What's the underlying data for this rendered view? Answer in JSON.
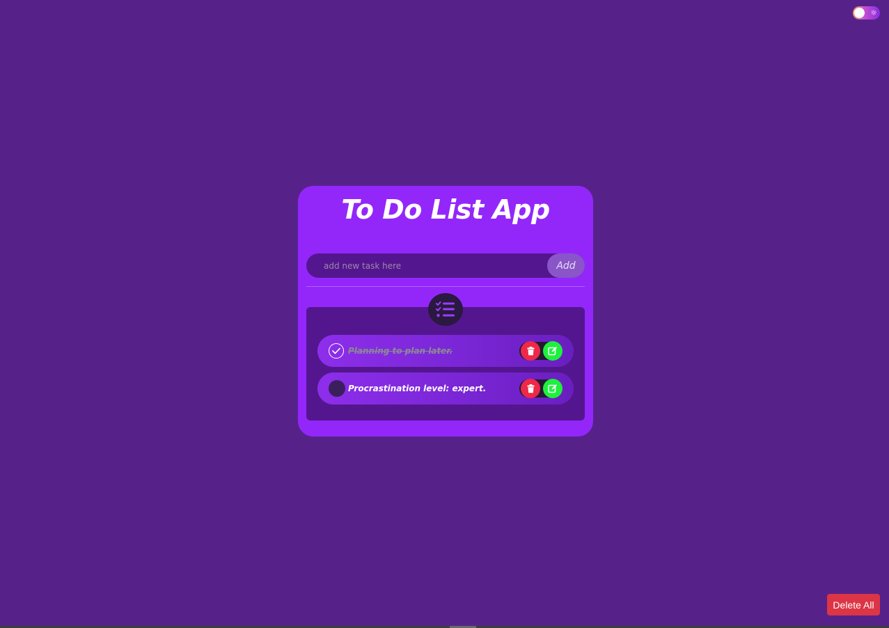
{
  "theme_toggle": {
    "state": "light",
    "icon": "sun-icon"
  },
  "app": {
    "title": "To Do List App",
    "input": {
      "placeholder": "add new task here",
      "value": ""
    },
    "add_label": "Add",
    "list_icon": "task-list-icon"
  },
  "tasks": [
    {
      "text": "Planning to plan later.",
      "completed": true
    },
    {
      "text": "Procrastination level: expert.",
      "completed": false
    }
  ],
  "footer": {
    "delete_all_label": "Delete All"
  },
  "colors": {
    "background": "#56228a",
    "card": "#9327fa",
    "panel": "#54168f",
    "delete": "#ee2849",
    "edit": "#1ef03e",
    "delete_all": "#dc3545"
  }
}
